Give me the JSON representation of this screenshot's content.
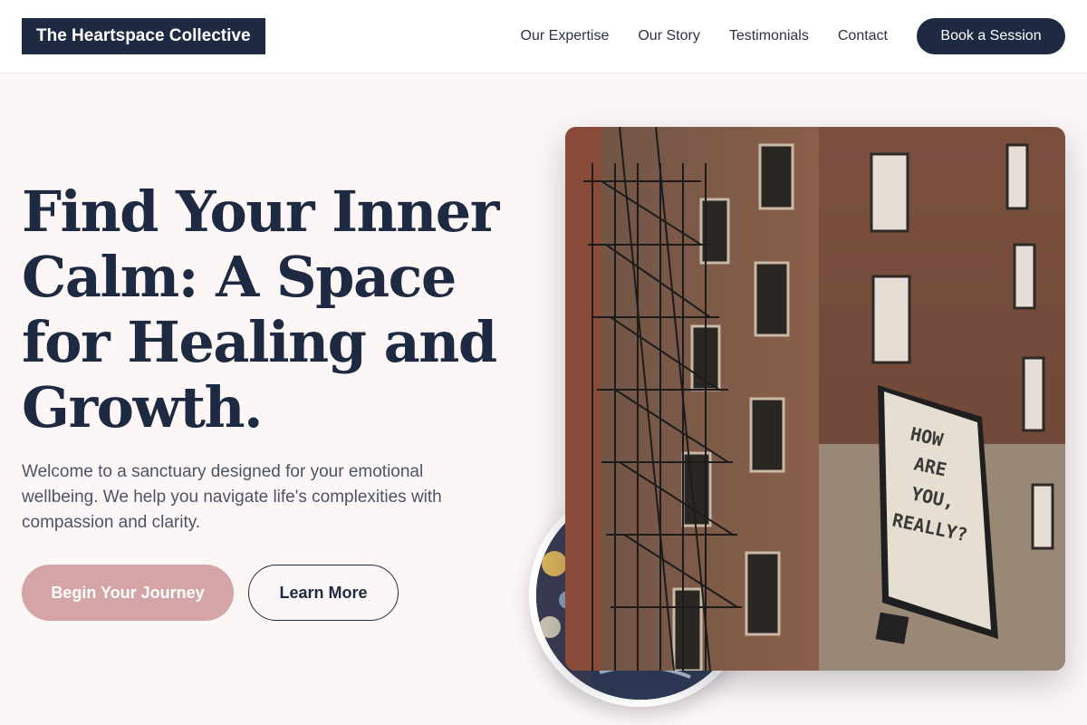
{
  "header": {
    "logo": "The Heartspace Collective",
    "nav": [
      {
        "label": "Our Expertise"
      },
      {
        "label": "Our Story"
      },
      {
        "label": "Testimonials"
      },
      {
        "label": "Contact"
      }
    ],
    "cta": "Book a Session"
  },
  "hero": {
    "title": "Find Your Inner Calm: A Space for Healing and Growth.",
    "subtitle": "Welcome to a sanctuary designed for your emotional wellbeing. We help you navigate life's complexities with compassion and clarity.",
    "primary_button": "Begin Your Journey",
    "secondary_button": "Learn More"
  },
  "images": {
    "main": {
      "mural_lines": [
        "HOW",
        "ARE",
        "YOU,",
        "REALLY?"
      ]
    }
  },
  "colors": {
    "navy": "#1e2a42",
    "rose": "#d5a4a6",
    "background": "#fdf6f6"
  }
}
